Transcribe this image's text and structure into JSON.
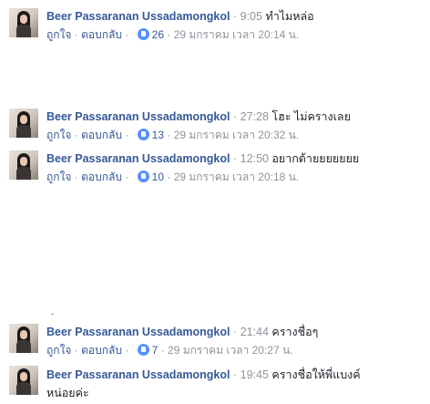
{
  "comments": [
    {
      "author": "Beer Passaranan Ussadamongkol",
      "time_marker": "9:05",
      "text": "ทำไมหล่อ",
      "like_label": "ถูกใจ",
      "reply_label": "ตอบกลับ",
      "like_count": "26",
      "timestamp": "29 มกราคม เวลา 20:14 น."
    },
    {
      "author": "Beer Passaranan Ussadamongkol",
      "time_marker": "27:28",
      "text": "โฮะ ไม่ครางเลย",
      "like_label": "ถูกใจ",
      "reply_label": "ตอบกลับ",
      "like_count": "13",
      "timestamp": "29 มกราคม เวลา 20:32 น."
    },
    {
      "author": "Beer Passaranan Ussadamongkol",
      "time_marker": "12:50",
      "text": "อยากด้ายยยยยยย",
      "like_label": "ถูกใจ",
      "reply_label": "ตอบกลับ",
      "like_count": "10",
      "timestamp": "29 มกราคม เวลา 20:18 น."
    },
    {
      "author": "Beer Passaranan Ussadamongkol",
      "time_marker": "21:44",
      "text": "ครางชื่อๆ",
      "like_label": "ถูกใจ",
      "reply_label": "ตอบกลับ",
      "like_count": "7",
      "timestamp": "29 มกราคม เวลา 20:27 น."
    },
    {
      "author": "Beer Passaranan Ussadamongkol",
      "time_marker": "19:45",
      "text": "ครางชื่อให้พี่แบงค์",
      "text_cont": "หน่อยค่ะ"
    }
  ],
  "separator": "·"
}
